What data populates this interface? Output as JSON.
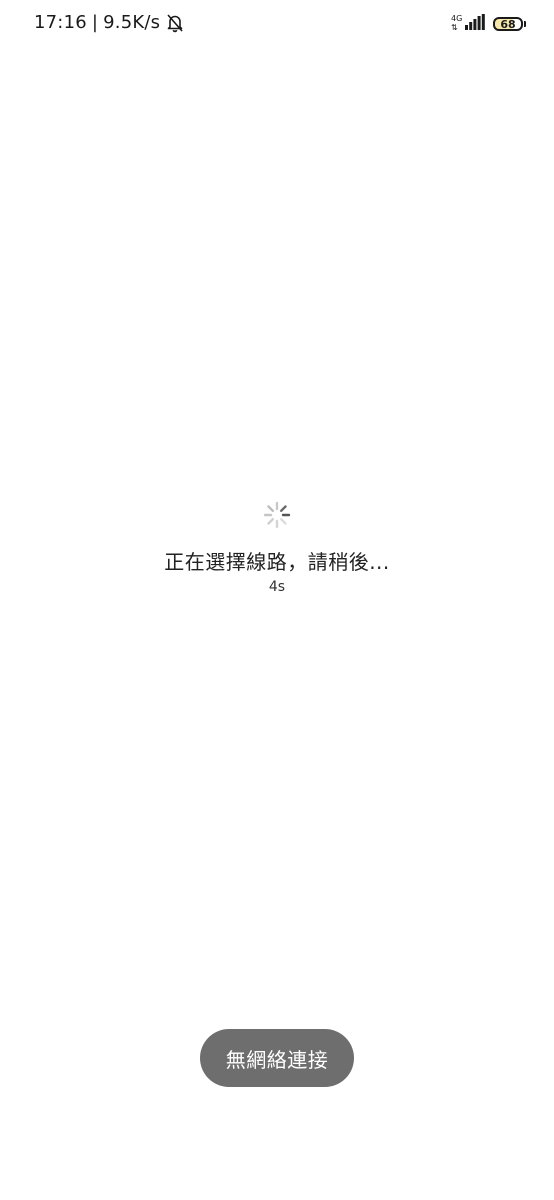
{
  "status_bar": {
    "time": "17:16",
    "separator": "|",
    "speed": "9.5K/s",
    "network_type": "4G",
    "battery_level": "68",
    "icons": [
      "bell-off-icon",
      "signal-icon",
      "battery-icon"
    ]
  },
  "loading": {
    "message": "正在選擇線路，請稍後...",
    "countdown": "4s"
  },
  "toast": {
    "message": "無網絡連接"
  },
  "colors": {
    "toast_bg": "#6e6e6e",
    "spinner": "#9a9a9a",
    "battery_fill": "#f7e7a8"
  }
}
